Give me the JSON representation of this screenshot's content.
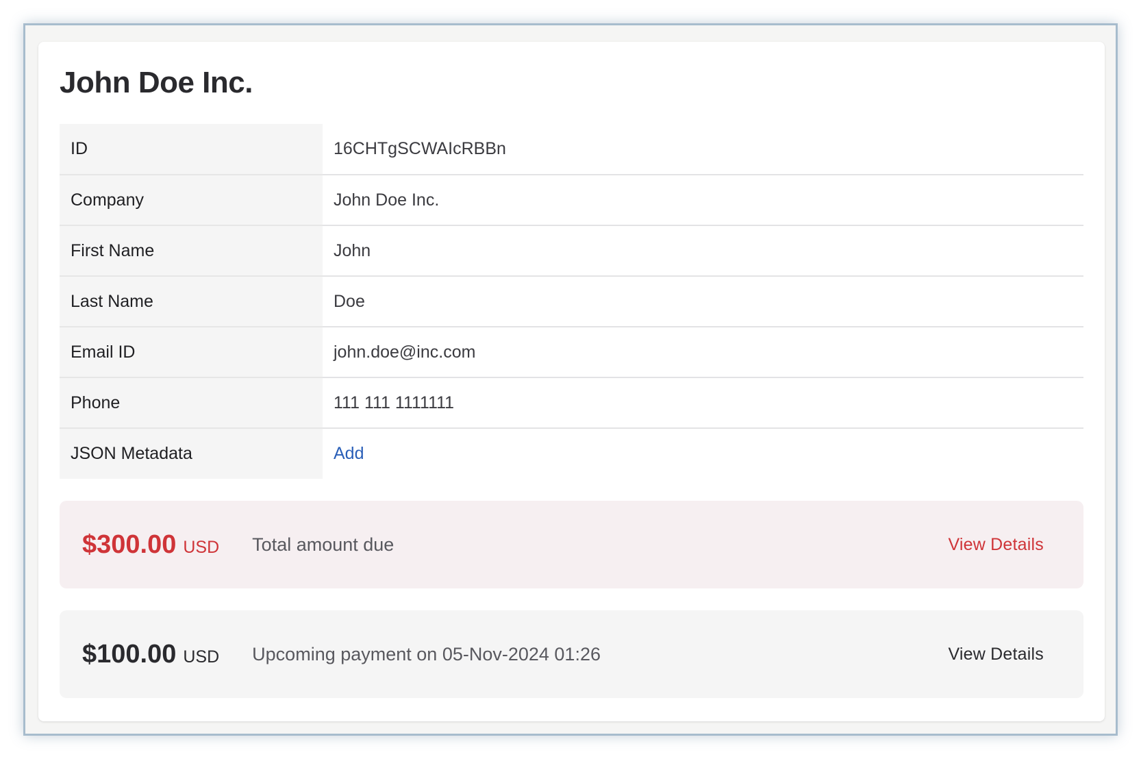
{
  "page": {
    "title": "John Doe Inc."
  },
  "details": [
    {
      "label": "ID",
      "value": "16CHTgSCWAIcRBBn"
    },
    {
      "label": "Company",
      "value": "John Doe Inc."
    },
    {
      "label": "First Name",
      "value": "John"
    },
    {
      "label": "Last Name",
      "value": "Doe"
    },
    {
      "label": "Email ID",
      "value": "john.doe@inc.com"
    },
    {
      "label": "Phone",
      "value": "111 111 1111111"
    },
    {
      "label": "JSON Metadata",
      "value": "Add"
    }
  ],
  "due": {
    "amount": "$300.00",
    "currency": "USD",
    "description": "Total amount due",
    "action_label": "View Details",
    "accent_color": "#cf3438"
  },
  "upcoming": {
    "amount": "$100.00",
    "currency": "USD",
    "description": "Upcoming payment on 05-Nov-2024 01:26",
    "action_label": "View Details"
  }
}
